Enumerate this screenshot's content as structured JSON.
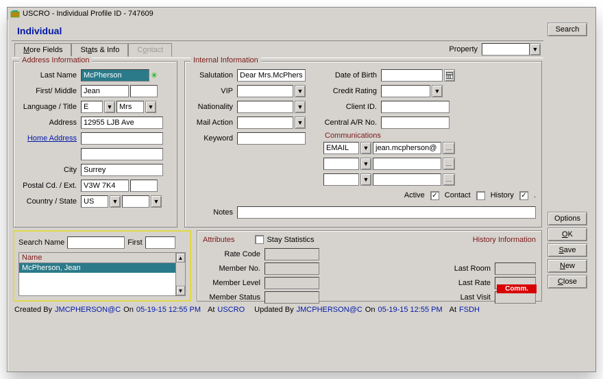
{
  "titlebar": {
    "text": "USCRO - Individual Profile ID - 747609"
  },
  "page_title": "Individual",
  "tabs": {
    "more_fields": "More Fields",
    "stats_info": "Stats & Info",
    "contact": "Contact"
  },
  "property_label": "Property",
  "address": {
    "legend": "Address Information",
    "last_name_lbl": "Last Name",
    "last_name": "McPherson",
    "first_lbl": "First/ Middle",
    "first": "Jean",
    "middle": "",
    "lang_title_lbl": "Language / Title",
    "lang": "E",
    "title": "Mrs",
    "address_lbl": "Address",
    "address1": "12955 LJB Ave",
    "home_addr_lbl": "Home Address",
    "address2": "",
    "address3": "",
    "city_lbl": "City",
    "city": "Surrey",
    "postal_lbl": "Postal Cd. / Ext.",
    "postal": "V3W 7K4",
    "postal_ext": "",
    "country_lbl": "Country / State",
    "country": "US",
    "state": ""
  },
  "internal": {
    "legend": "Internal Information",
    "salutation_lbl": "Salutation",
    "salutation": "Dear Mrs.McPhers",
    "vip_lbl": "VIP",
    "nationality_lbl": "Nationality",
    "mailaction_lbl": "Mail Action",
    "keyword_lbl": "Keyword",
    "dob_lbl": "Date of Birth",
    "credit_lbl": "Credit Rating",
    "client_lbl": "Client ID.",
    "car_lbl": "Central A/R No.",
    "comm_legend": "Communications",
    "comm_type": "EMAIL",
    "comm_value": "jean.mcpherson@",
    "active_lbl": "Active",
    "contact_lbl": "Contact",
    "history_lbl": "History",
    "active": true,
    "contact": false,
    "history": true,
    "notes_lbl": "Notes"
  },
  "search": {
    "name_lbl": "Search Name",
    "first_lbl": "First",
    "header": "Name",
    "row0": "McPherson, Jean"
  },
  "attr": {
    "attributes_lbl": "Attributes",
    "stay_stats_lbl": "Stay Statistics",
    "history_lbl": "History Information",
    "rate_lbl": "Rate Code",
    "memberno_lbl": "Member No.",
    "memberlvl_lbl": "Member Level",
    "memberstat_lbl": "Member Status",
    "lastroom_lbl": "Last Room",
    "lastrate_lbl": "Last Rate",
    "lastvisit_lbl": "Last Visit"
  },
  "comm_badge": "Comm.",
  "footer": {
    "created_by_lbl": "Created By",
    "created_by": "JMCPHERSON@C",
    "on_lbl": "On",
    "created_on": "05-19-15 12:55 PM",
    "at_lbl": "At",
    "created_at": "USCRO",
    "updated_by_lbl": "Updated By",
    "updated_by": "JMCPHERSON@C",
    "updated_on": "05-19-15 12:55 PM",
    "updated_at": "FSDH"
  },
  "buttons": {
    "search": "Search",
    "options": "Options",
    "ok": "OK",
    "save": "Save",
    "new": "New",
    "close": "Close"
  }
}
